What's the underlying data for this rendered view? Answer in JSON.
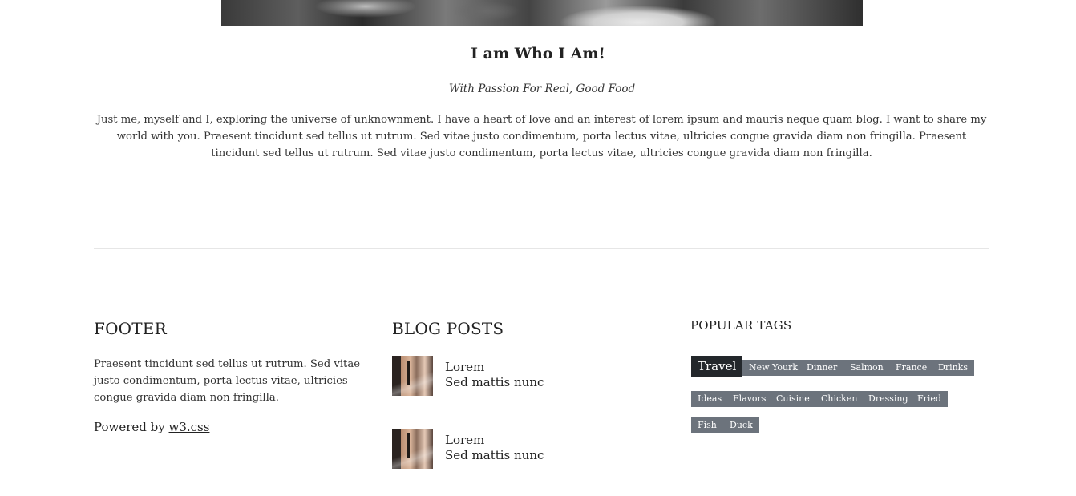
{
  "about": {
    "title": "I am Who I Am!",
    "subtitle": "With Passion For Real, Good Food",
    "text": "Just me, myself and I, exploring the universe of unknownment. I have a heart of love and an interest of lorem ipsum and mauris neque quam blog. I want to share my world with you. Praesent tincidunt sed tellus ut rutrum. Sed vitae justo condimentum, porta lectus vitae, ultricies congue gravida diam non fringilla. Praesent tincidunt sed tellus ut rutrum. Sed vitae justo condimentum, porta lectus vitae, ultricies congue gravida diam non fringilla."
  },
  "footer": {
    "heading": "FOOTER",
    "text": "Praesent tincidunt sed tellus ut rutrum. Sed vitae justo condimentum, porta lectus vitae, ultricies congue gravida diam non fringilla.",
    "powered_prefix": "Powered by ",
    "powered_link": "w3.css"
  },
  "blog": {
    "heading": "BLOG POSTS",
    "posts": [
      {
        "title": "Lorem",
        "subtitle": "Sed mattis nunc"
      },
      {
        "title": "Lorem",
        "subtitle": "Sed mattis nunc"
      }
    ]
  },
  "tags": {
    "heading": "POPULAR TAGS",
    "items": [
      "Travel",
      "New Yourk",
      "Dinner",
      "Salmon",
      "France",
      "Drinks",
      "Ideas",
      "Flavors",
      "Cuisine",
      "Chicken",
      "Dressing",
      "Fried",
      "Fish",
      "Duck"
    ]
  },
  "colors": {
    "tag_bg": "#6c737c",
    "tag_main_bg": "#23272b"
  }
}
